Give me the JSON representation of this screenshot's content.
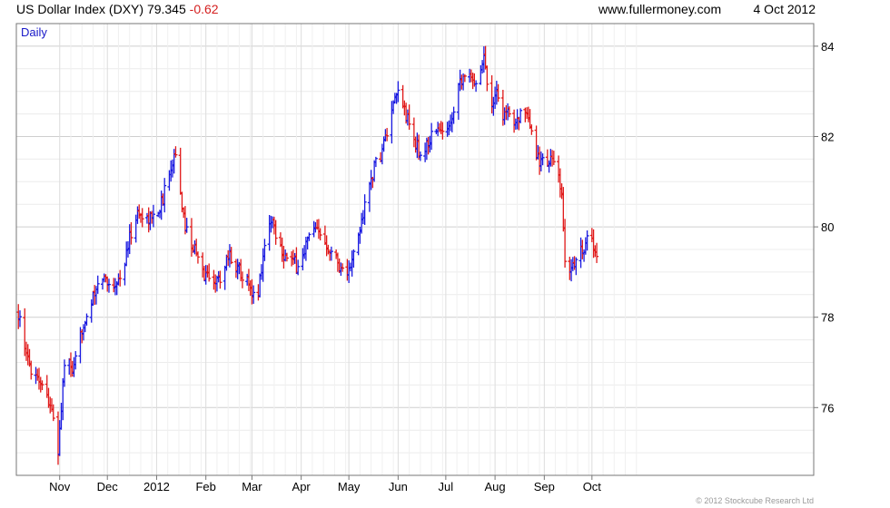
{
  "header": {
    "title": "US Dollar Index (DXY)",
    "price": "79.345",
    "change": "-0.62",
    "site": "www.fullermoney.com",
    "date": "4 Oct 2012"
  },
  "copyright": "© 2012 Stockcube Research Ltd",
  "colors": {
    "up": "#1818e0",
    "down": "#e01818",
    "grid": "#dedede",
    "label": "#1818c8"
  },
  "chart_data": {
    "type": "bar",
    "subtitle": "Daily",
    "ylim": [
      74.5,
      84.5
    ],
    "y_ticks": [
      "76",
      "78",
      "80",
      "82",
      "84"
    ],
    "x_ticks": [
      "Nov",
      "Dec",
      "2012",
      "Feb",
      "Mar",
      "Apr",
      "May",
      "Jun",
      "Jul",
      "Aug",
      "Sep",
      "Oct"
    ],
    "grid": true,
    "series": [
      {
        "close_keypoints": [
          [
            "Oct 6",
            78.1
          ],
          [
            "Oct 10",
            77.2
          ],
          [
            "Oct 14",
            76.9
          ],
          [
            "Oct 20",
            76.6
          ],
          [
            "Oct 26",
            76.1
          ],
          [
            "Oct 31",
            75.0
          ],
          [
            "Nov 4",
            77.0
          ],
          [
            "Nov 10",
            76.8
          ],
          [
            "Nov 16",
            77.9
          ],
          [
            "Nov 22",
            78.4
          ],
          [
            "Nov 28",
            78.9
          ],
          [
            "Dec 4",
            78.7
          ],
          [
            "Dec 10",
            78.9
          ],
          [
            "Dec 16",
            79.9
          ],
          [
            "Dec 20",
            80.3
          ],
          [
            "Dec 26",
            80.2
          ],
          [
            "Dec 30",
            80.2
          ],
          [
            "Jan 5",
            80.6
          ],
          [
            "Jan 9",
            81.3
          ],
          [
            "Jan 13",
            81.7
          ],
          [
            "Jan 17",
            80.3
          ],
          [
            "Jan 21",
            79.8
          ],
          [
            "Jan 25",
            79.5
          ],
          [
            "Jan 29",
            79.0
          ],
          [
            "Feb 3",
            78.9
          ],
          [
            "Feb 9",
            78.8
          ],
          [
            "Feb 15",
            79.4
          ],
          [
            "Feb 21",
            79.1
          ],
          [
            "Feb 26",
            78.9
          ],
          [
            "Mar 1",
            78.4
          ],
          [
            "Mar 5",
            78.6
          ],
          [
            "Mar 9",
            79.6
          ],
          [
            "Mar 13",
            80.2
          ],
          [
            "Mar 17",
            79.8
          ],
          [
            "Mar 21",
            79.4
          ],
          [
            "Mar 27",
            79.2
          ],
          [
            "Mar 31",
            79.1
          ],
          [
            "Apr 4",
            79.6
          ],
          [
            "Apr 8",
            79.9
          ],
          [
            "Apr 14",
            79.8
          ],
          [
            "Apr 20",
            79.5
          ],
          [
            "Apr 26",
            79.1
          ],
          [
            "May 1",
            79.0
          ],
          [
            "May 6",
            79.6
          ],
          [
            "May 10",
            80.3
          ],
          [
            "May 16",
            81.2
          ],
          [
            "May 21",
            81.6
          ],
          [
            "May 26",
            82.2
          ],
          [
            "Jun 1",
            83.0
          ],
          [
            "Jun 5",
            82.6
          ],
          [
            "Jun 9",
            82.1
          ],
          [
            "Jun 15",
            81.6
          ],
          [
            "Jun 19",
            81.8
          ],
          [
            "Jun 25",
            82.2
          ],
          [
            "Jun 30",
            82.0
          ],
          [
            "Jul 5",
            82.5
          ],
          [
            "Jul 9",
            83.2
          ],
          [
            "Jul 13",
            83.4
          ],
          [
            "Jul 18",
            83.2
          ],
          [
            "Jul 22",
            83.4
          ],
          [
            "Jul 25",
            83.8
          ],
          [
            "Jul 29",
            82.7
          ],
          [
            "Aug 2",
            83.0
          ],
          [
            "Aug 6",
            82.5
          ],
          [
            "Aug 12",
            82.4
          ],
          [
            "Aug 18",
            82.5
          ],
          [
            "Aug 22",
            82.3
          ],
          [
            "Aug 27",
            81.6
          ],
          [
            "Aug 31",
            81.4
          ],
          [
            "Sep 4",
            81.5
          ],
          [
            "Sep 8",
            81.4
          ],
          [
            "Sep 12",
            80.6
          ],
          [
            "Sep 14",
            79.3
          ],
          [
            "Sep 16",
            79.0
          ],
          [
            "Sep 20",
            79.2
          ],
          [
            "Sep 26",
            79.6
          ],
          [
            "Sep 30",
            79.8
          ],
          [
            "Oct 4",
            79.345
          ]
        ]
      }
    ]
  }
}
